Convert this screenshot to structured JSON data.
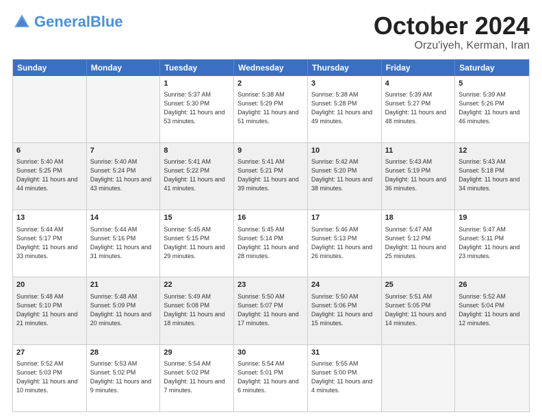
{
  "header": {
    "logo_general": "General",
    "logo_blue": "Blue",
    "month": "October 2024",
    "location": "Orzu'iyeh, Kerman, Iran"
  },
  "weekdays": [
    "Sunday",
    "Monday",
    "Tuesday",
    "Wednesday",
    "Thursday",
    "Friday",
    "Saturday"
  ],
  "rows": [
    [
      {
        "day": "",
        "sunrise": "",
        "sunset": "",
        "daylight": "",
        "empty": true
      },
      {
        "day": "",
        "sunrise": "",
        "sunset": "",
        "daylight": "",
        "empty": true
      },
      {
        "day": "1",
        "sunrise": "Sunrise: 5:37 AM",
        "sunset": "Sunset: 5:30 PM",
        "daylight": "Daylight: 11 hours and 53 minutes."
      },
      {
        "day": "2",
        "sunrise": "Sunrise: 5:38 AM",
        "sunset": "Sunset: 5:29 PM",
        "daylight": "Daylight: 11 hours and 51 minutes."
      },
      {
        "day": "3",
        "sunrise": "Sunrise: 5:38 AM",
        "sunset": "Sunset: 5:28 PM",
        "daylight": "Daylight: 11 hours and 49 minutes."
      },
      {
        "day": "4",
        "sunrise": "Sunrise: 5:39 AM",
        "sunset": "Sunset: 5:27 PM",
        "daylight": "Daylight: 11 hours and 48 minutes."
      },
      {
        "day": "5",
        "sunrise": "Sunrise: 5:39 AM",
        "sunset": "Sunset: 5:26 PM",
        "daylight": "Daylight: 11 hours and 46 minutes."
      }
    ],
    [
      {
        "day": "6",
        "sunrise": "Sunrise: 5:40 AM",
        "sunset": "Sunset: 5:25 PM",
        "daylight": "Daylight: 11 hours and 44 minutes."
      },
      {
        "day": "7",
        "sunrise": "Sunrise: 5:40 AM",
        "sunset": "Sunset: 5:24 PM",
        "daylight": "Daylight: 11 hours and 43 minutes."
      },
      {
        "day": "8",
        "sunrise": "Sunrise: 5:41 AM",
        "sunset": "Sunset: 5:22 PM",
        "daylight": "Daylight: 11 hours and 41 minutes."
      },
      {
        "day": "9",
        "sunrise": "Sunrise: 5:41 AM",
        "sunset": "Sunset: 5:21 PM",
        "daylight": "Daylight: 11 hours and 39 minutes."
      },
      {
        "day": "10",
        "sunrise": "Sunrise: 5:42 AM",
        "sunset": "Sunset: 5:20 PM",
        "daylight": "Daylight: 11 hours and 38 minutes."
      },
      {
        "day": "11",
        "sunrise": "Sunrise: 5:43 AM",
        "sunset": "Sunset: 5:19 PM",
        "daylight": "Daylight: 11 hours and 36 minutes."
      },
      {
        "day": "12",
        "sunrise": "Sunrise: 5:43 AM",
        "sunset": "Sunset: 5:18 PM",
        "daylight": "Daylight: 11 hours and 34 minutes."
      }
    ],
    [
      {
        "day": "13",
        "sunrise": "Sunrise: 5:44 AM",
        "sunset": "Sunset: 5:17 PM",
        "daylight": "Daylight: 11 hours and 33 minutes."
      },
      {
        "day": "14",
        "sunrise": "Sunrise: 5:44 AM",
        "sunset": "Sunset: 5:16 PM",
        "daylight": "Daylight: 11 hours and 31 minutes."
      },
      {
        "day": "15",
        "sunrise": "Sunrise: 5:45 AM",
        "sunset": "Sunset: 5:15 PM",
        "daylight": "Daylight: 11 hours and 29 minutes."
      },
      {
        "day": "16",
        "sunrise": "Sunrise: 5:45 AM",
        "sunset": "Sunset: 5:14 PM",
        "daylight": "Daylight: 11 hours and 28 minutes."
      },
      {
        "day": "17",
        "sunrise": "Sunrise: 5:46 AM",
        "sunset": "Sunset: 5:13 PM",
        "daylight": "Daylight: 11 hours and 26 minutes."
      },
      {
        "day": "18",
        "sunrise": "Sunrise: 5:47 AM",
        "sunset": "Sunset: 5:12 PM",
        "daylight": "Daylight: 11 hours and 25 minutes."
      },
      {
        "day": "19",
        "sunrise": "Sunrise: 5:47 AM",
        "sunset": "Sunset: 5:11 PM",
        "daylight": "Daylight: 11 hours and 23 minutes."
      }
    ],
    [
      {
        "day": "20",
        "sunrise": "Sunrise: 5:48 AM",
        "sunset": "Sunset: 5:10 PM",
        "daylight": "Daylight: 11 hours and 21 minutes."
      },
      {
        "day": "21",
        "sunrise": "Sunrise: 5:48 AM",
        "sunset": "Sunset: 5:09 PM",
        "daylight": "Daylight: 11 hours and 20 minutes."
      },
      {
        "day": "22",
        "sunrise": "Sunrise: 5:49 AM",
        "sunset": "Sunset: 5:08 PM",
        "daylight": "Daylight: 11 hours and 18 minutes."
      },
      {
        "day": "23",
        "sunrise": "Sunrise: 5:50 AM",
        "sunset": "Sunset: 5:07 PM",
        "daylight": "Daylight: 11 hours and 17 minutes."
      },
      {
        "day": "24",
        "sunrise": "Sunrise: 5:50 AM",
        "sunset": "Sunset: 5:06 PM",
        "daylight": "Daylight: 11 hours and 15 minutes."
      },
      {
        "day": "25",
        "sunrise": "Sunrise: 5:51 AM",
        "sunset": "Sunset: 5:05 PM",
        "daylight": "Daylight: 11 hours and 14 minutes."
      },
      {
        "day": "26",
        "sunrise": "Sunrise: 5:52 AM",
        "sunset": "Sunset: 5:04 PM",
        "daylight": "Daylight: 11 hours and 12 minutes."
      }
    ],
    [
      {
        "day": "27",
        "sunrise": "Sunrise: 5:52 AM",
        "sunset": "Sunset: 5:03 PM",
        "daylight": "Daylight: 11 hours and 10 minutes."
      },
      {
        "day": "28",
        "sunrise": "Sunrise: 5:53 AM",
        "sunset": "Sunset: 5:02 PM",
        "daylight": "Daylight: 11 hours and 9 minutes."
      },
      {
        "day": "29",
        "sunrise": "Sunrise: 5:54 AM",
        "sunset": "Sunset: 5:02 PM",
        "daylight": "Daylight: 11 hours and 7 minutes."
      },
      {
        "day": "30",
        "sunrise": "Sunrise: 5:54 AM",
        "sunset": "Sunset: 5:01 PM",
        "daylight": "Daylight: 11 hours and 6 minutes."
      },
      {
        "day": "31",
        "sunrise": "Sunrise: 5:55 AM",
        "sunset": "Sunset: 5:00 PM",
        "daylight": "Daylight: 11 hours and 4 minutes."
      },
      {
        "day": "",
        "sunrise": "",
        "sunset": "",
        "daylight": "",
        "empty": true
      },
      {
        "day": "",
        "sunrise": "",
        "sunset": "",
        "daylight": "",
        "empty": true
      }
    ]
  ]
}
